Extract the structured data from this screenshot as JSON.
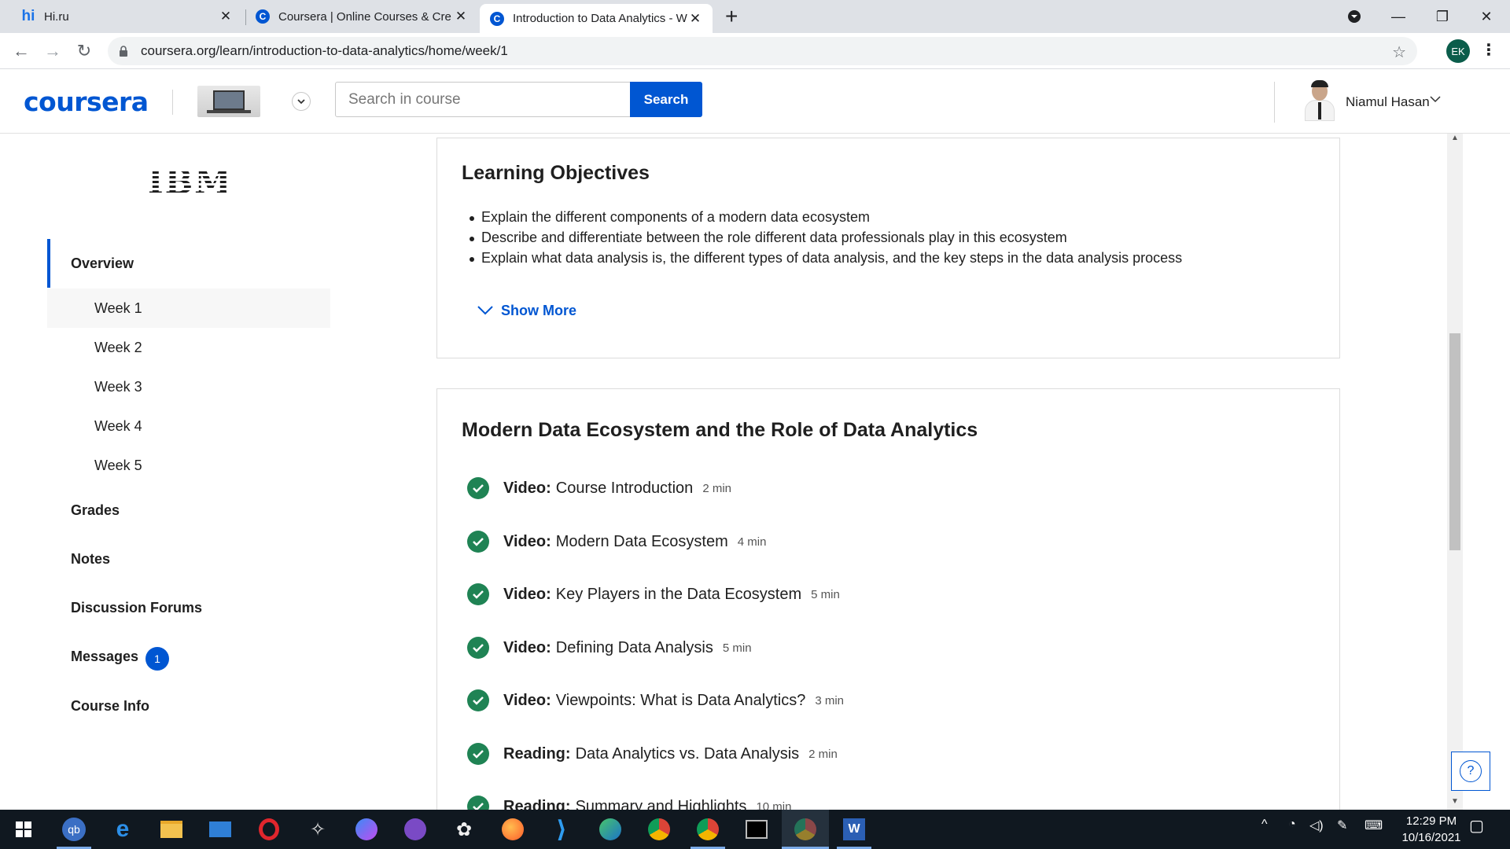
{
  "browser": {
    "tabs": [
      {
        "title": "Hi.ru",
        "icon": "hi-icon"
      },
      {
        "title": "Coursera | Online Courses & Cre",
        "icon": "coursera-icon"
      },
      {
        "title": "Introduction to Data Analytics - W",
        "icon": "coursera-icon"
      }
    ],
    "url": "coursera.org/learn/introduction-to-data-analytics/home/week/1",
    "profile_initials": "EK"
  },
  "header": {
    "logo": "coursera",
    "search_placeholder": "Search in course",
    "search_button": "Search",
    "username": "Niamul Hasan"
  },
  "sidebar": {
    "partner_logo": "IBM",
    "overview": "Overview",
    "weeks": [
      "Week 1",
      "Week 2",
      "Week 3",
      "Week 4",
      "Week 5"
    ],
    "grades": "Grades",
    "notes": "Notes",
    "forums": "Discussion Forums",
    "messages": "Messages",
    "messages_count": "1",
    "course_info": "Course Info"
  },
  "objectives": {
    "title": "Learning Objectives",
    "items": [
      "Explain the different components of a modern data ecosystem",
      "Describe and differentiate between the role different data professionals play in this ecosystem",
      "Explain what data analysis is, the different types of data analysis, and the key steps in the data analysis process"
    ],
    "show_more": "Show More"
  },
  "module": {
    "title": "Modern Data Ecosystem and the Role of Data Analytics",
    "lessons": [
      {
        "type": "Video:",
        "title": "Course Introduction",
        "duration": "2 min"
      },
      {
        "type": "Video:",
        "title": "Modern Data Ecosystem",
        "duration": "4 min"
      },
      {
        "type": "Video:",
        "title": "Key Players in the Data Ecosystem",
        "duration": "5 min"
      },
      {
        "type": "Video:",
        "title": "Defining Data Analysis",
        "duration": "5 min"
      },
      {
        "type": "Video:",
        "title": "Viewpoints: What is Data Analytics?",
        "duration": "3 min"
      },
      {
        "type": "Reading:",
        "title": "Data Analytics vs. Data Analysis",
        "duration": "2 min"
      },
      {
        "type": "Reading:",
        "title": "Summary and Highlights",
        "duration": "10 min"
      }
    ]
  },
  "taskbar": {
    "time": "12:29 PM",
    "date": "10/16/2021"
  },
  "colors": {
    "brand": "#0056d2",
    "complete": "#1f8354"
  }
}
